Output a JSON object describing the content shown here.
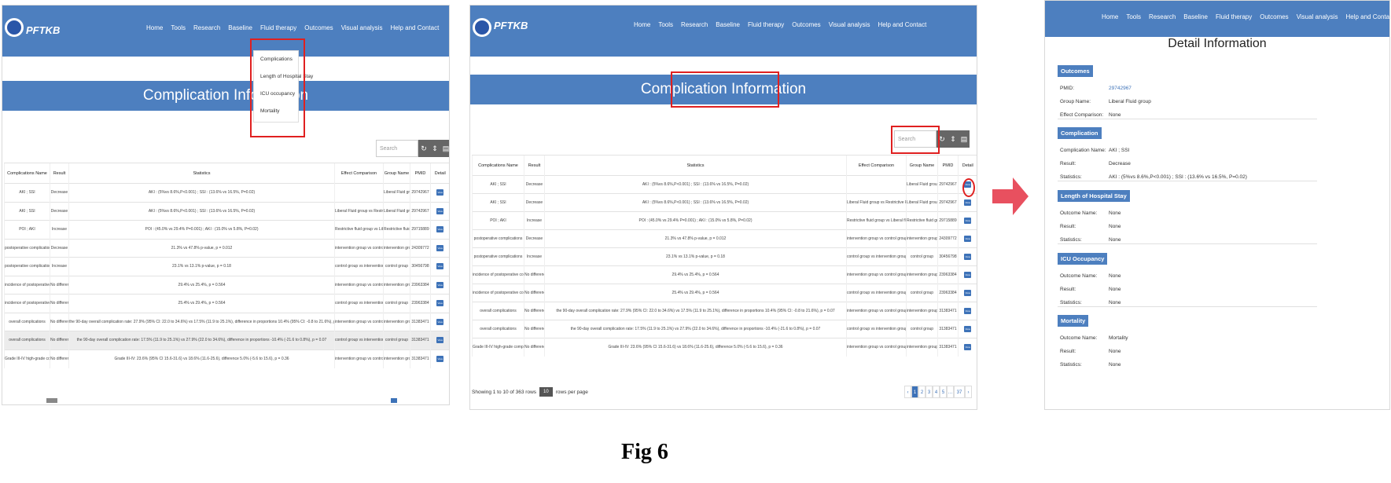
{
  "brand": "PFTKB",
  "nav": [
    "Home",
    "Tools",
    "Research",
    "Baseline",
    "Fluid therapy",
    "Outcomes",
    "Visual analysis",
    "Help and Contact"
  ],
  "outcomes_menu": [
    "Complications",
    "Length of Hospital Stay",
    "ICU occupancy",
    "Mortality"
  ],
  "page_title": "Complication Information",
  "search_placeholder": "Search",
  "toolbar_icons": [
    "refresh-icon",
    "columns-icon",
    "export-icon"
  ],
  "colors": {
    "primary": "#4d7fbf",
    "highlight": "#e02020",
    "arrow": "#e8505f"
  },
  "table": {
    "headers": [
      "Complications Name",
      "Result",
      "Statistics",
      "Effect Comparison",
      "Group Name",
      "PMID",
      "Detail"
    ],
    "view_label": "View",
    "rows": [
      {
        "name": "AKI ; SSI",
        "result": "Decrease",
        "stats": "AKI : (5%vs 8.6%,P<0.001) ; SSI : (13.6% vs 16.5%, P=0.02)",
        "effect": "",
        "group": "Liberal Fluid group",
        "pmid": "29742967"
      },
      {
        "name": "AKI ; SSI",
        "result": "Decrease",
        "stats": "AKI : (5%vs 8.6%,P<0.001) ; SSI : (13.6% vs 16.5%, P=0.02)",
        "effect": "Liberal Fluid group vs Restrictive Fluid group",
        "group": "Liberal Fluid group",
        "pmid": "29742967"
      },
      {
        "name": "POI ; AKI",
        "result": "Increase",
        "stats": "POI : (45.0% vs 29.4% P=0.001) ; AKI : (15.0% vs 5.8%, P=0.02)",
        "effect": "Restrictive fluid group vs Liberal fluid group",
        "group": "Restrictive fluid group",
        "pmid": "29715889"
      },
      {
        "name": "postoperative complications",
        "result": "Decrease",
        "stats": "21.3% vs 47.8% p-value, p = 0.012",
        "effect": "intervention group vs control group",
        "group": "intervention group",
        "pmid": "24309772"
      },
      {
        "name": "postoperative complications",
        "result": "Increase",
        "stats": "23.1% vs 13.1% p-value, p = 0.18",
        "effect": "control group vs intervention group",
        "group": "control group",
        "pmid": "30456798"
      },
      {
        "name": "incidence of postoperative complications",
        "result": "No difference",
        "stats": "29.4% vs 25.4%, p = 0.564",
        "effect": "intervention group vs control group",
        "group": "intervention group",
        "pmid": "23963384"
      },
      {
        "name": "incidence of postoperative complications",
        "result": "No difference",
        "stats": "25.4% vs 29.4%, p = 0.564",
        "effect": "control group vs intervention group",
        "group": "control group",
        "pmid": "23963384"
      },
      {
        "name": "overall complications",
        "result": "No difference",
        "stats": "the 90-day overall complication rate: 27.9% (95% CI: 22.0 to 34.6%) vs 17.5% (11.9 to 25.1%), difference in proportions 10.4% (95% CI: -0.8 to 21.6%), p = 0.07",
        "effect": "intervention group vs control group",
        "group": "intervention group",
        "pmid": "31383471"
      },
      {
        "name": "overall complications",
        "result": "No difference",
        "stats": "the 90-day overall complication rate: 17.5% (11.9 to 25.1%) vs 27.9% (22.0 to 34.6%), difference in proportions -10.4% (-21.6 to 0.8%), p = 0.07",
        "effect": "control group vs intervention group",
        "group": "control group",
        "pmid": "31383471"
      },
      {
        "name": "Grade III-IV high-grade complications",
        "result": "No difference",
        "stats": "Grade III-IV: 23.6% (95% CI 15.6-31.6) vs 18.6% (11.6-25.6), difference 5.0% (-5.6 to 15.6), p = 0.36",
        "effect": "intervention group vs control group",
        "group": "intervention group",
        "pmid": "31383471"
      }
    ]
  },
  "footer": {
    "showing_text": "Showing 1 to 10 of 363 rows",
    "page_size": "10",
    "per_page_text": "rows per page",
    "pages": [
      "‹",
      "1",
      "2",
      "3",
      "4",
      "5",
      "…",
      "37",
      "›"
    ]
  },
  "detail": {
    "title": "Detail Information",
    "outcomes_head": "Outcomes",
    "pmid_label": "PMID:",
    "pmid_value": "29742967",
    "group_label": "Group Name:",
    "group_value": "Liberal Fluid group",
    "effect_label": "Effect Comparison:",
    "effect_value": "None",
    "complication_head": "Complication",
    "comp_name_label": "Complication Name:",
    "comp_name_value": "AKI ; SSI",
    "comp_result_label": "Result:",
    "comp_result_value": "Decrease",
    "comp_stats_label": "Statistics:",
    "comp_stats_value": "AKI : (5%vs 8.6%,P<0.001) ; SSI : (13.6% vs 16.5%, P=0.02)",
    "los_head": "Length of Hospital Stay",
    "icu_head": "ICU Occupancy",
    "mort_head": "Mortality",
    "outcome_name_label": "Outcome Name:",
    "result_label": "Result:",
    "stats_label": "Statistics:",
    "none": "None",
    "mortality_value": "Mortality"
  },
  "caption": "Fig 6"
}
